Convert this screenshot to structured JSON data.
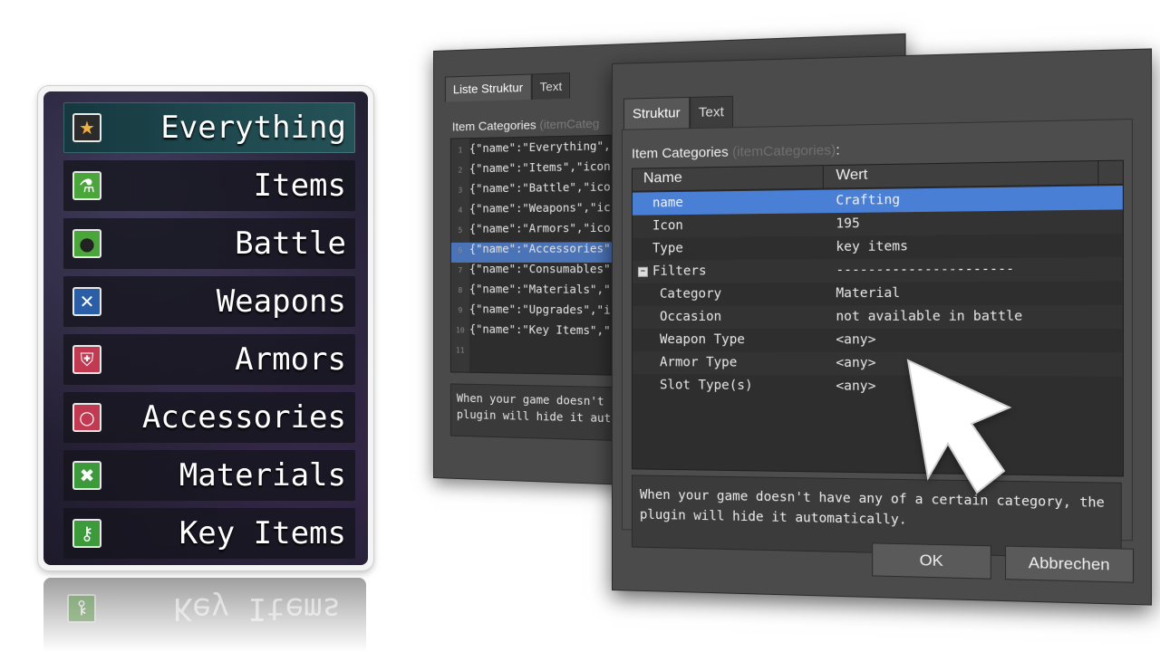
{
  "menu": {
    "items": [
      {
        "label": "Everything",
        "icon": "star-icon",
        "icon_color": "#2b2b2b",
        "glyph": "★",
        "glyph_color": "#f0b040",
        "selected": true
      },
      {
        "label": "Items",
        "icon": "potion-icon",
        "icon_color": "#4aa63a",
        "glyph": "⚗",
        "glyph_color": "#ffffff",
        "selected": false
      },
      {
        "label": "Battle",
        "icon": "bomb-icon",
        "icon_color": "#4aa63a",
        "glyph": "●",
        "glyph_color": "#222222",
        "selected": false
      },
      {
        "label": "Weapons",
        "icon": "sword-icon",
        "icon_color": "#2a5fa8",
        "glyph": "✕",
        "glyph_color": "#ffffff",
        "selected": false
      },
      {
        "label": "Armors",
        "icon": "shield-icon",
        "icon_color": "#c23a52",
        "glyph": "⛨",
        "glyph_color": "#ffffff",
        "selected": false
      },
      {
        "label": "Accessories",
        "icon": "ring-icon",
        "icon_color": "#c23a52",
        "glyph": "○",
        "glyph_color": "#ffffff",
        "selected": false
      },
      {
        "label": "Materials",
        "icon": "tools-icon",
        "icon_color": "#3c9a3a",
        "glyph": "✖",
        "glyph_color": "#ffffff",
        "selected": false
      },
      {
        "label": "Key Items",
        "icon": "key-icon",
        "icon_color": "#3c9a3a",
        "glyph": "⚷",
        "glyph_color": "#ffffff",
        "selected": false
      }
    ],
    "reflection_label": "Key Items"
  },
  "back_window": {
    "tabs": [
      "Liste Struktur",
      "Text"
    ],
    "title": "Item Categories",
    "title_dim": "(itemCateg",
    "lines": [
      "{\"name\":\"Everything\",",
      "{\"name\":\"Items\",\"icon",
      "{\"name\":\"Battle\",\"ico",
      "{\"name\":\"Weapons\",\"ic",
      "{\"name\":\"Armors\",\"ico",
      "{\"name\":\"Accessories\"",
      "{\"name\":\"Consumables\"",
      "{\"name\":\"Materials\",\"",
      "{\"name\":\"Upgrades\",\"i",
      "{\"name\":\"Key Items\",\"",
      ""
    ],
    "selected_line": 6,
    "help_line1": "When your game doesn't ha",
    "help_line2": "plugin will hide it autom"
  },
  "front_window": {
    "tabs": [
      "Struktur",
      "Text"
    ],
    "title": "Item Categories",
    "title_dim": "(itemCategories)",
    "title_suffix": ":",
    "col_name": "Name",
    "col_value": "Wert",
    "rows": [
      {
        "key": "name",
        "value": "Crafting",
        "indent": 1,
        "selected": true
      },
      {
        "key": "Icon",
        "value": "195",
        "indent": 1
      },
      {
        "key": "Type",
        "value": "key items",
        "indent": 1
      },
      {
        "key": "Filters",
        "value": "----------------------",
        "indent": 0,
        "collapse": "−"
      },
      {
        "key": "Category",
        "value": "Material",
        "indent": 2
      },
      {
        "key": "Occasion",
        "value": "not available in battle",
        "indent": 2
      },
      {
        "key": "Weapon Type",
        "value": "<any>",
        "indent": 2
      },
      {
        "key": "Armor Type",
        "value": "<any>",
        "indent": 2
      },
      {
        "key": "Slot Type(s)",
        "value": "<any>",
        "indent": 2
      }
    ],
    "help_line1": "When your game doesn't have any of a certain category, the",
    "help_line2": "plugin will hide it automatically.",
    "ok_label": "OK",
    "cancel_label": "Abbrechen"
  },
  "cursor_icon": "mouse-pointer-icon"
}
